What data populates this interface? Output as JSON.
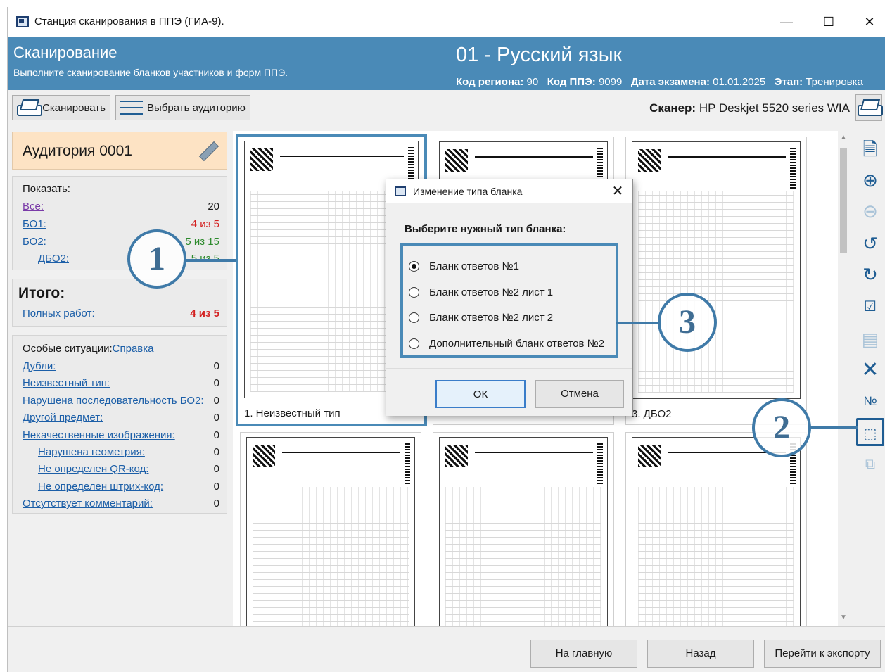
{
  "window": {
    "title": "Станция сканирования в ППЭ (ГИА-9).",
    "min_glyph": "—",
    "max_glyph": "☐",
    "close_glyph": "✕"
  },
  "header": {
    "title": "Сканирование",
    "subtitle": "Выполните сканирование бланков участников и форм ППЭ.",
    "subject": "01 - Русский язык",
    "region_label": "Код региона:",
    "region_value": "90",
    "ppe_label": "Код ППЭ:",
    "ppe_value": "9099",
    "date_label": "Дата экзамена:",
    "date_value": "01.01.2025",
    "stage_label": "Этап:",
    "stage_value": "Тренировка",
    "bg_color": "#4a8ab7"
  },
  "toolbar": {
    "scan_label": "Сканировать",
    "choose_room_label": "Выбрать аудиторию",
    "scanner_label": "Сканер:",
    "scanner_value": "HP Deskjet 5520 series WIA"
  },
  "left": {
    "room_title": "Аудитория 0001",
    "show_label": "Показать:",
    "show_items": [
      {
        "label": "Все:",
        "value": "20"
      },
      {
        "label": "БО1:",
        "value": "4 из 5"
      },
      {
        "label": "БО2:",
        "value": "5 из 15"
      },
      {
        "label": "ДБО2:",
        "value": "5 из 5"
      }
    ],
    "total_label": "Итого:",
    "full_works_label": "Полных работ:",
    "full_works_value": "4 из 5",
    "special_label": "Особые ситуации:",
    "help_link": "Справка",
    "special_items": [
      {
        "label": "Дубли:",
        "value": "0"
      },
      {
        "label": "Неизвестный тип:",
        "value": "0"
      },
      {
        "label": "Нарушена последовательность БО2:",
        "value": "0"
      },
      {
        "label": "Другой предмет:",
        "value": "0"
      },
      {
        "label": "Некачественные изображения:",
        "value": "0"
      },
      {
        "label": "Нарушена геометрия:",
        "value": "0"
      },
      {
        "label": "Не определен QR-код:",
        "value": "0"
      },
      {
        "label": "Не определен штрих-код:",
        "value": "0"
      },
      {
        "label": "Отсутствует комментарий:",
        "value": "0"
      }
    ]
  },
  "thumbs": [
    {
      "caption": "1. Неизвестный тип"
    },
    {
      "caption": ""
    },
    {
      "caption": "3. ДБО2"
    }
  ],
  "bottom": {
    "home_label": "На главную",
    "back_label": "Назад",
    "export_label": "Перейти к экспорту"
  },
  "dialog": {
    "title": "Изменение типа бланка",
    "prompt": "Выберите нужный тип бланка:",
    "options": [
      {
        "label": "Бланк ответов №1",
        "selected": true
      },
      {
        "label": "Бланк ответов №2 лист 1",
        "selected": false
      },
      {
        "label": "Бланк ответов №2 лист 2",
        "selected": false
      },
      {
        "label": "Дополнительный бланк ответов №2",
        "selected": false
      }
    ],
    "ok_label": "ОК",
    "cancel_label": "Отмена",
    "close_glyph": "✕"
  },
  "callouts": [
    "1",
    "2",
    "3"
  ],
  "icons": {
    "right_bar": [
      "view-page-icon",
      "zoom-in-icon",
      "zoom-out-icon",
      "rotate-left-icon",
      "rotate-right-icon",
      "checklist-icon",
      "comment-icon",
      "delete-icon",
      "numbering-icon",
      "change-type-icon",
      "copy-type-icon"
    ]
  }
}
